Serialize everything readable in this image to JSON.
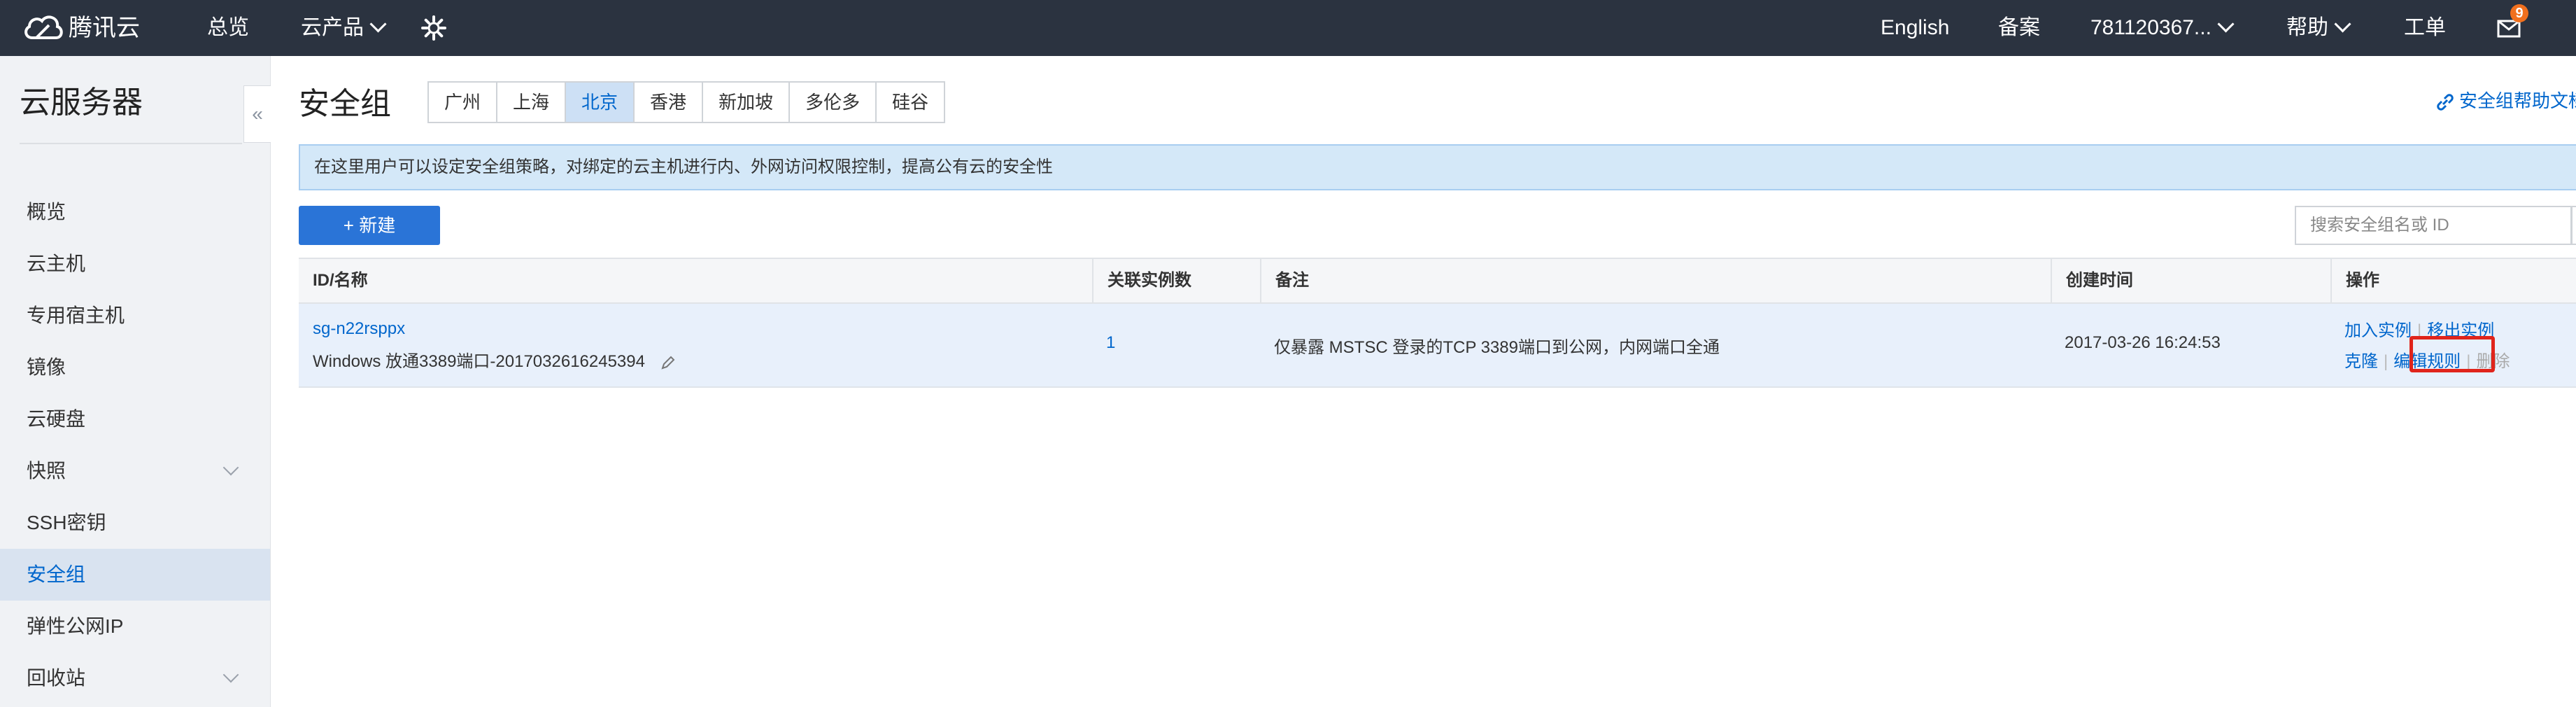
{
  "topbar": {
    "brand": "腾讯云",
    "overview": "总览",
    "products": "云产品",
    "english": "English",
    "beian": "备案",
    "account": "781120367...",
    "help": "帮助",
    "ticket": "工单",
    "message_count": "9"
  },
  "sidebar": {
    "title": "云服务器",
    "items": [
      {
        "label": "概览"
      },
      {
        "label": "云主机"
      },
      {
        "label": "专用宿主机"
      },
      {
        "label": "镜像"
      },
      {
        "label": "云硬盘"
      },
      {
        "label": "快照"
      },
      {
        "label": "SSH密钥"
      },
      {
        "label": "安全组"
      },
      {
        "label": "弹性公网IP"
      },
      {
        "label": "回收站"
      }
    ],
    "active_index": 7
  },
  "main": {
    "page_title": "安全组",
    "regions": [
      "广州",
      "上海",
      "北京",
      "香港",
      "新加坡",
      "多伦多",
      "硅谷"
    ],
    "active_region": "北京",
    "help_link": "安全组帮助文档",
    "notice": "在这里用户可以设定安全组策略，对绑定的云主机进行内、外网访问权限控制，提高公有云的安全性",
    "new_button": "+ 新建",
    "search_placeholder": "搜索安全组名或 ID"
  },
  "table": {
    "columns": [
      "ID/名称",
      "关联实例数",
      "备注",
      "创建时间",
      "操作"
    ],
    "rows": [
      {
        "id": "sg-n22rsppx",
        "name": "Windows 放通3389端口-2017032616245394",
        "instances": "1",
        "remark": "仅暴露 MSTSC 登录的TCP 3389端口到公网，内网端口全通",
        "created": "2017-03-26 16:24:53",
        "ops": {
          "add_instance": "加入实例",
          "remove_instance": "移出实例",
          "clone": "克隆",
          "edit_rules": "编辑规则",
          "delete": "删除"
        }
      }
    ]
  },
  "colors": {
    "topbar_bg": "#2b3340",
    "accent": "#0066cc",
    "highlight": "#e0241b"
  }
}
